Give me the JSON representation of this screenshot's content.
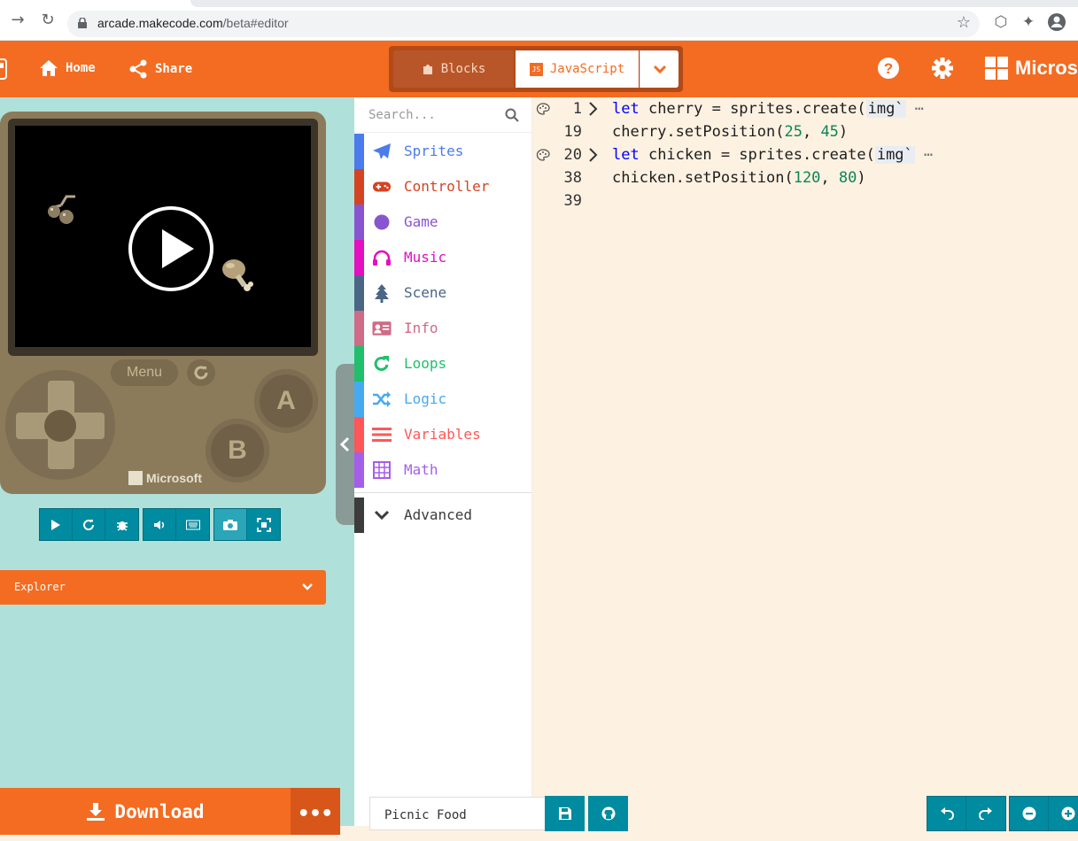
{
  "browser": {
    "url_host": "arcade.makecode.com",
    "url_path": "/beta#editor"
  },
  "header": {
    "home_label": "Home",
    "share_label": "Share",
    "blocks_label": "Blocks",
    "javascript_label": "JavaScript",
    "js_badge": "JS",
    "brand": "Microso"
  },
  "simulator": {
    "menu_label": "Menu",
    "a_label": "A",
    "b_label": "B",
    "brand": "Microsoft"
  },
  "explorer_label": "Explorer",
  "download_label": "Download",
  "download_more": "•••",
  "toolbox": {
    "search_placeholder": "Search...",
    "categories": [
      {
        "label": "Sprites",
        "color": "#4b7bec",
        "icon": "paper-plane-icon"
      },
      {
        "label": "Controller",
        "color": "#d54322",
        "icon": "gamepad-icon"
      },
      {
        "label": "Game",
        "color": "#8854d0",
        "icon": "circle-icon"
      },
      {
        "label": "Music",
        "color": "#e30fc0",
        "icon": "headphones-icon"
      },
      {
        "label": "Scene",
        "color": "#4b6584",
        "icon": "tree-icon"
      },
      {
        "label": "Info",
        "color": "#cf6a87",
        "icon": "id-card-icon"
      },
      {
        "label": "Loops",
        "color": "#20bf6b",
        "icon": "refresh-icon"
      },
      {
        "label": "Logic",
        "color": "#45aaf2",
        "icon": "shuffle-icon"
      },
      {
        "label": "Variables",
        "color": "#ff5757",
        "icon": "list-icon"
      },
      {
        "label": "Math",
        "color": "#a55eea",
        "icon": "calculator-icon"
      }
    ],
    "advanced_label": "Advanced"
  },
  "code": {
    "lines": [
      {
        "ln": "1",
        "pre": "let",
        "mid": " cherry = sprites.create(",
        "img": "img`",
        "post": " ⋯",
        "fold": true
      },
      {
        "ln": "19",
        "text": "cherry.setPosition(",
        "a": "25",
        "sep": ", ",
        "b": "45",
        "end": ")"
      },
      {
        "ln": "20",
        "pre": "let",
        "mid": " chicken = sprites.create(",
        "img": "img`",
        "post": " ⋯",
        "fold": true
      },
      {
        "ln": "38",
        "text": "chicken.setPosition(",
        "a": "120",
        "sep": ", ",
        "b": "80",
        "end": ")"
      },
      {
        "ln": "39"
      }
    ]
  },
  "project_name": "Picnic Food",
  "colors": {
    "accent": "#f36c21",
    "sim_bg": "#b0e0da",
    "editor_bg": "#fdf1e1",
    "teal_button": "#008ba0"
  }
}
